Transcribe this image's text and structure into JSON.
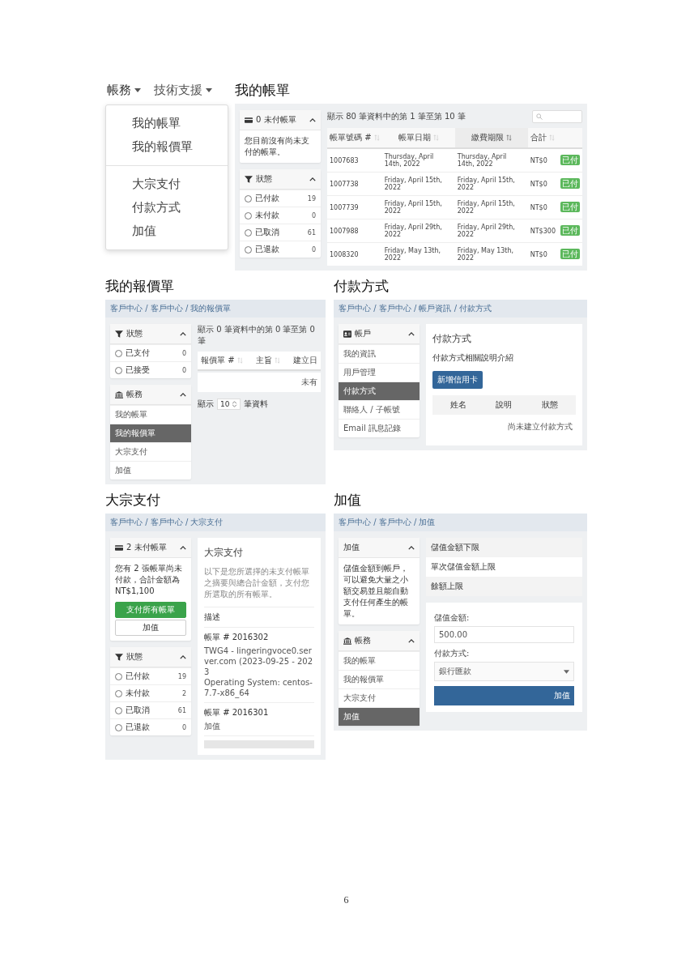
{
  "top_menu": [
    {
      "label": "帳務",
      "expanded": true,
      "dropdown": [
        [
          "我的帳單",
          "我的報價單"
        ],
        [
          "大宗支付",
          "付款方式",
          "加值"
        ]
      ]
    },
    {
      "label": "技術支援",
      "expanded": false
    }
  ],
  "sections": [
    {
      "kind": "invoices",
      "title": "我的帳單",
      "sidebar": [
        {
          "kind": "unpaid",
          "title": "0 未付帳單",
          "text": "您目前沒有尚未支付的帳單。"
        },
        {
          "kind": "status",
          "title": "狀態",
          "items": [
            {
              "label": "已付款",
              "count": "19"
            },
            {
              "label": "未付款",
              "count": "0"
            },
            {
              "label": "已取消",
              "count": "61"
            },
            {
              "label": "已退款",
              "count": "0"
            }
          ]
        }
      ],
      "main": {
        "info": "顯示 80 筆資料中的第 1 筆至第 10 筆",
        "columns": [
          {
            "label": "帳單號碼 #",
            "sorted": false
          },
          {
            "label": "帳單日期",
            "sorted": false
          },
          {
            "label": "繳費期限",
            "sorted": true
          },
          {
            "label": "合計",
            "sorted": false
          }
        ],
        "rows": [
          {
            "cells": [
              "1007683",
              "Thursday, April 14th, 2022",
              "Thursday, April 14th, 2022",
              "NT$0"
            ],
            "status": "已付"
          },
          {
            "cells": [
              "1007738",
              "Friday, April 15th, 2022",
              "Friday, April 15th, 2022",
              "NT$0"
            ],
            "status": "已付"
          },
          {
            "cells": [
              "1007739",
              "Friday, April 15th, 2022",
              "Friday, April 15th, 2022",
              "NT$0"
            ],
            "status": "已付"
          },
          {
            "cells": [
              "1007988",
              "Friday, April 29th, 2022",
              "Friday, April 29th, 2022",
              "NT$300"
            ],
            "status": "已付"
          },
          {
            "cells": [
              "1008320",
              "Friday, May 13th, 2022",
              "Friday, May 13th, 2022",
              "NT$0"
            ],
            "status": "已付"
          }
        ]
      }
    },
    {
      "kind": "quotes",
      "title": "我的報價單",
      "breadcrumb": "客戶中心 / 客戶中心 / 我的報價單",
      "sidebar": [
        {
          "kind": "status",
          "title": "狀態",
          "items": [
            {
              "label": "已支付",
              "count": "0"
            },
            {
              "label": "已接受",
              "count": "0"
            }
          ]
        },
        {
          "kind": "billing",
          "title": "帳務",
          "items": [
            {
              "label": "我的帳單",
              "selected": false
            },
            {
              "label": "我的報價單",
              "selected": true
            },
            {
              "label": "大宗支付",
              "selected": false
            },
            {
              "label": "加值",
              "selected": false
            }
          ]
        }
      ],
      "main": {
        "info": "顯示 0 筆資料中的第 0 筆至第 0 筆",
        "columns": [
          {
            "label": "報價單 #"
          },
          {
            "label": "主旨"
          },
          {
            "label": "建立日"
          }
        ],
        "empty": "未有",
        "show_label": "顯示",
        "page_size": "10",
        "show_suffix": "筆資料"
      }
    },
    {
      "kind": "payment_methods",
      "title": "付款方式",
      "breadcrumb": "客戶中心 / 客戶中心 / 帳戶資訊 / 付款方式",
      "sidebar": [
        {
          "kind": "account",
          "title": "帳戶",
          "items": [
            {
              "label": "我的資訊",
              "selected": false
            },
            {
              "label": "用戶管理",
              "selected": false
            },
            {
              "label": "付款方式",
              "selected": true
            },
            {
              "label": "聯絡人 / 子帳號",
              "selected": false
            },
            {
              "label": "Email 訊息記錄",
              "selected": false
            }
          ]
        }
      ],
      "main": {
        "heading": "付款方式",
        "text": "付款方式相關說明介紹",
        "button": "新增信用卡",
        "columns": [
          "姓名",
          "說明",
          "狀態"
        ],
        "empty": "尚未建立付款方式"
      }
    },
    {
      "kind": "mass_pay",
      "title": "大宗支付",
      "breadcrumb": "客戶中心 / 客戶中心 / 大宗支付",
      "sidebar": [
        {
          "kind": "unpaid",
          "title": "2 未付帳單",
          "text": "您有 2 張帳單尚未付款，合計金額為 NT$1,100",
          "buttons": [
            "支付所有帳單",
            "加值"
          ]
        },
        {
          "kind": "status",
          "title": "狀態",
          "items": [
            {
              "label": "已付款",
              "count": "19"
            },
            {
              "label": "未付款",
              "count": "2"
            },
            {
              "label": "已取消",
              "count": "61"
            },
            {
              "label": "已退款",
              "count": "0"
            }
          ]
        }
      ],
      "main": {
        "heading": "大宗支付",
        "text": "以下是您所選擇的未支付帳單之摘要與總合計金額，支付您所選取的所有帳單。",
        "list_header": "描述",
        "invoices": [
          {
            "title": "帳單 # 2016302",
            "lines": [
              "TWG4 - lingeringvoce0.server.com (2023-09-25 - 2023",
              "Operating System: centos-7.7-x86_64"
            ]
          },
          {
            "title": "帳單 # 2016301",
            "lines": [
              "加值"
            ]
          }
        ]
      }
    },
    {
      "kind": "add_funds",
      "title": "加值",
      "breadcrumb": "客戶中心 / 客戶中心 / 加值",
      "sidebar": [
        {
          "kind": "info",
          "title": "加值",
          "text": "儲值金額到帳戶，可以避免大量之小額交易並且能自動支付任何產生的帳單。"
        },
        {
          "kind": "billing",
          "title": "帳務",
          "items": [
            {
              "label": "我的帳單",
              "selected": false
            },
            {
              "label": "我的報價單",
              "selected": false
            },
            {
              "label": "大宗支付",
              "selected": false
            },
            {
              "label": "加值",
              "selected": true
            }
          ]
        }
      ],
      "main": {
        "limits": [
          "儲值金額下限",
          "單次儲值金額上限",
          "餘額上限"
        ],
        "fields": [
          {
            "label": "儲值金額:",
            "value": "500.00",
            "kind": "input"
          },
          {
            "label": "付款方式:",
            "value": "銀行匯款",
            "kind": "select"
          }
        ],
        "button": "加值"
      }
    }
  ],
  "page_number": "6"
}
